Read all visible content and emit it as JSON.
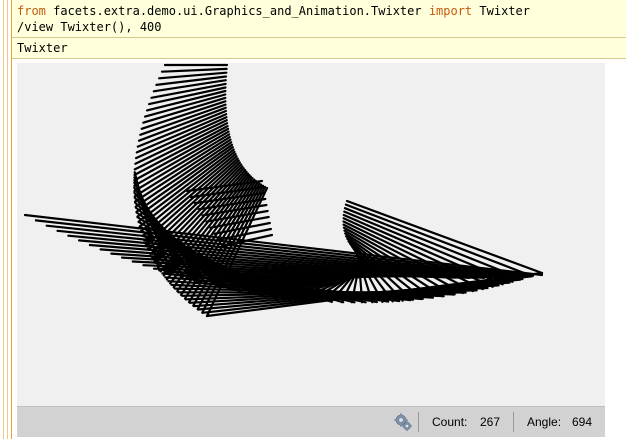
{
  "editor": {
    "code_line1": {
      "kw_from": "from",
      "module": " facets.extra.demo.ui.Graphics_and_Animation.Twixter ",
      "kw_import": "import",
      "name": " Twixter"
    },
    "code_line2": "/view Twixter(), 400"
  },
  "output": {
    "title": "Twixter"
  },
  "twixter": {
    "line_color": "#000000",
    "background": "#f0f0f0"
  },
  "statusbar": {
    "icon": "gears-icon",
    "count_label": "Count:",
    "count_value": "267",
    "angle_label": "Angle:",
    "angle_value": "694"
  }
}
